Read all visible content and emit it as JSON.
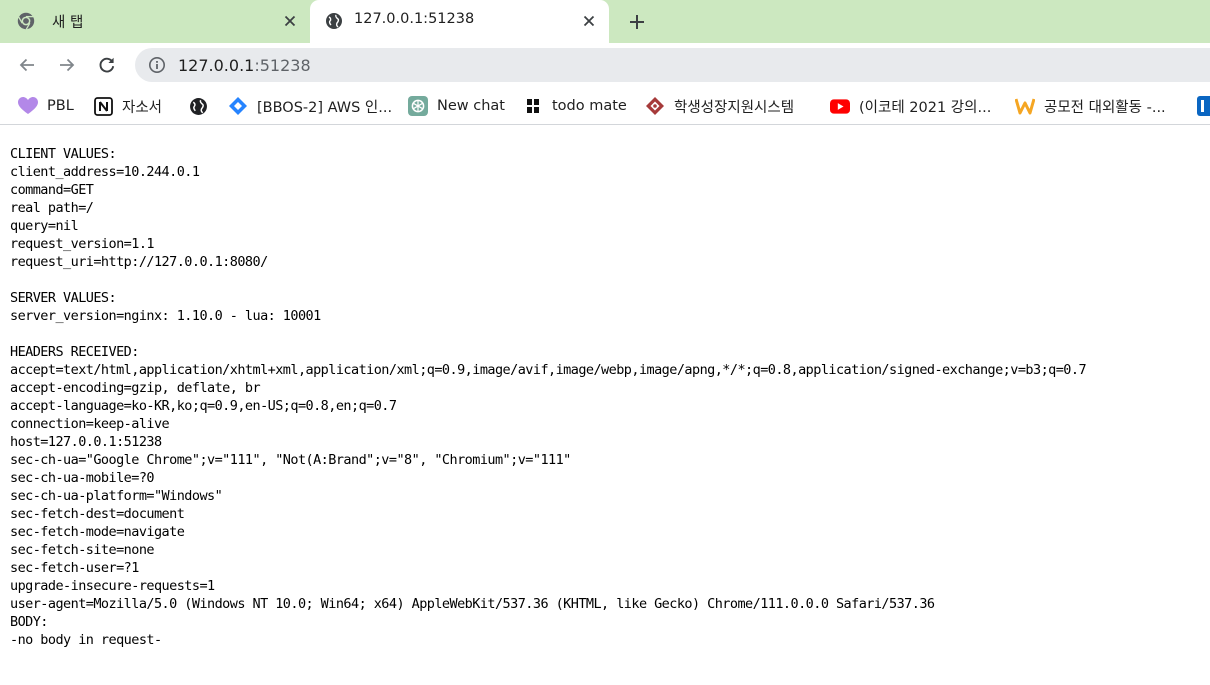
{
  "browser": {
    "tabs": [
      {
        "title": "새 탭",
        "icon": "chrome-logo-icon",
        "active": false
      },
      {
        "title": "127.0.0.1:51238",
        "icon": "globe-icon",
        "active": true
      }
    ],
    "address_host": "127.0.0.1",
    "address_port": ":51238",
    "accent_color": "#cce8c0"
  },
  "bookmarks": [
    {
      "label": "PBL",
      "icon": "purple-heart-icon"
    },
    {
      "label": "자소서",
      "icon": "notion-icon"
    },
    {
      "label": "",
      "icon": "globe-icon"
    },
    {
      "label": "[BBOS-2] AWS 인...",
      "icon": "jira-icon"
    },
    {
      "label": "New chat",
      "icon": "chatgpt-icon"
    },
    {
      "label": "todo mate",
      "icon": "todo-mate-icon"
    },
    {
      "label": "학생성장지원시스템",
      "icon": "university-emblem-icon"
    },
    {
      "label": "(이코테 2021 강의...",
      "icon": "youtube-icon"
    },
    {
      "label": "공모전 대외활동 -...",
      "icon": "w-logo-icon"
    },
    {
      "label": "",
      "icon": "blue-app-icon"
    }
  ],
  "page": {
    "lines": [
      "CLIENT VALUES:",
      "client_address=10.244.0.1",
      "command=GET",
      "real path=/",
      "query=nil",
      "request_version=1.1",
      "request_uri=http://127.0.0.1:8080/",
      "",
      "SERVER VALUES:",
      "server_version=nginx: 1.10.0 - lua: 10001",
      "",
      "HEADERS RECEIVED:",
      "accept=text/html,application/xhtml+xml,application/xml;q=0.9,image/avif,image/webp,image/apng,*/*;q=0.8,application/signed-exchange;v=b3;q=0.7",
      "accept-encoding=gzip, deflate, br",
      "accept-language=ko-KR,ko;q=0.9,en-US;q=0.8,en;q=0.7",
      "connection=keep-alive",
      "host=127.0.0.1:51238",
      "sec-ch-ua=\"Google Chrome\";v=\"111\", \"Not(A:Brand\";v=\"8\", \"Chromium\";v=\"111\"",
      "sec-ch-ua-mobile=?0",
      "sec-ch-ua-platform=\"Windows\"",
      "sec-fetch-dest=document",
      "sec-fetch-mode=navigate",
      "sec-fetch-site=none",
      "sec-fetch-user=?1",
      "upgrade-insecure-requests=1",
      "user-agent=Mozilla/5.0 (Windows NT 10.0; Win64; x64) AppleWebKit/537.36 (KHTML, like Gecko) Chrome/111.0.0.0 Safari/537.36",
      "BODY:",
      "-no body in request-"
    ]
  }
}
